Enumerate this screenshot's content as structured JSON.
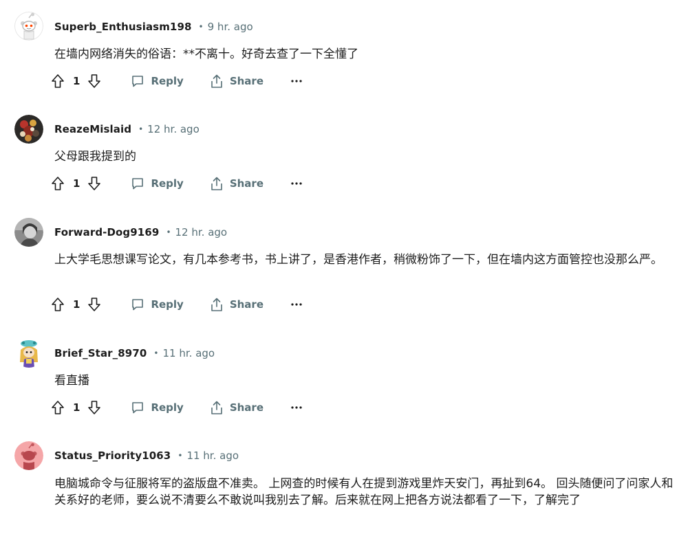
{
  "actions": {
    "reply_label": "Reply",
    "share_label": "Share"
  },
  "comments": [
    {
      "username": "Superb_Enthusiasm198",
      "time": "9 hr. ago",
      "text": "在墙内网络消失的俗语：**不离十。好奇去查了一下全懂了",
      "score": "1",
      "avatar": "reddit-snoo-default-avatar"
    },
    {
      "username": "ReazeMislaid",
      "time": "12 hr. ago",
      "text": "父母跟我提到的",
      "score": "1",
      "avatar": "user-photo-avatar"
    },
    {
      "username": "Forward-Dog9169",
      "time": "12 hr. ago",
      "text": "上大学毛思想课写论文，有几本参考书，书上讲了，是香港作者，稍微粉饰了一下，但在墙内这方面管控也没那么严。",
      "score": "1",
      "avatar": "user-photo-avatar"
    },
    {
      "username": "Brief_Star_8970",
      "time": "11 hr. ago",
      "text": "看直播",
      "score": "1",
      "avatar": "custom-snoo-avatar"
    },
    {
      "username": "Status_Priority1063",
      "time": "11 hr. ago",
      "text": "电脑城命令与征服将军的盗版盘不准卖。 上网查的时候有人在提到游戏里炸天安门，再扯到64。 回头随便问了问家人和关系好的老师，要么说不清要么不敢说叫我别去了解。后来就在网上把各方说法都看了一下，了解完了",
      "avatar": "reddit-snoo-default-avatar"
    }
  ]
}
